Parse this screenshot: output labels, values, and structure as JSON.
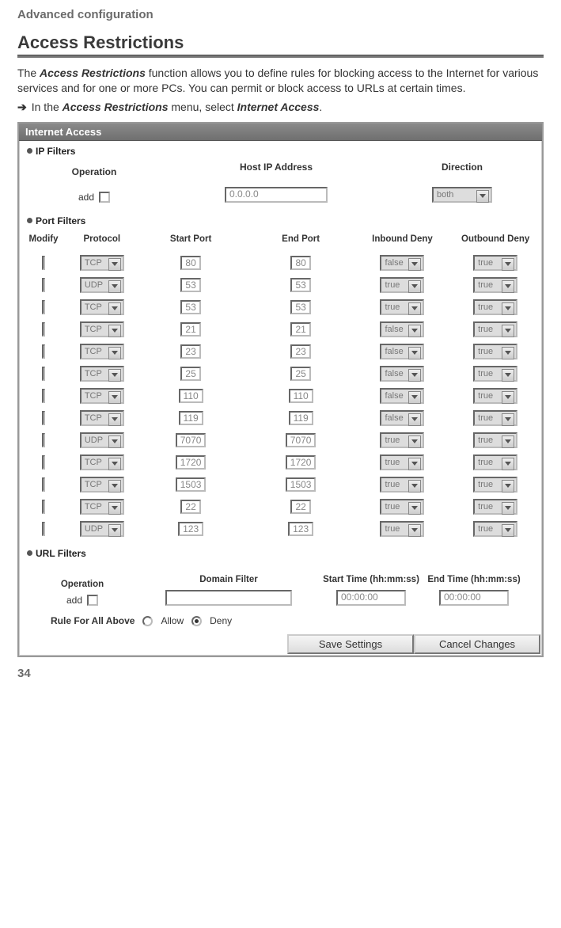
{
  "breadcrumb": "Advanced configuration",
  "section_title": "Access Restrictions",
  "intro_pre": "The ",
  "intro_bold1": "Access Restrictions",
  "intro_post1": " function allows you to define rules for blocking access to the Internet for various services and for one or more PCs. You can permit or block access to URLs at certain times.",
  "step_pre": "In the ",
  "step_bold1": "Access Restrictions",
  "step_mid": " menu, select ",
  "step_bold2": "Internet Access",
  "step_post": ".",
  "panel_title": "Internet Access",
  "ip_filters_label": "IP Filters",
  "ip_cols": {
    "c1": "Operation",
    "c2": "Host IP Address",
    "c3": "Direction"
  },
  "ip_add_label": "add",
  "ip_host_value": "0.0.0.0",
  "ip_direction": "both",
  "port_filters_label": "Port Filters",
  "port_cols": {
    "c1": "Modify",
    "c2": "Protocol",
    "c3": "Start Port",
    "c4": "End Port",
    "c5": "Inbound Deny",
    "c6": "Outbound Deny"
  },
  "port_rows": [
    {
      "protocol": "TCP",
      "start": "80",
      "end": "80",
      "inbound": "false",
      "outbound": "true"
    },
    {
      "protocol": "UDP",
      "start": "53",
      "end": "53",
      "inbound": "true",
      "outbound": "true"
    },
    {
      "protocol": "TCP",
      "start": "53",
      "end": "53",
      "inbound": "true",
      "outbound": "true"
    },
    {
      "protocol": "TCP",
      "start": "21",
      "end": "21",
      "inbound": "false",
      "outbound": "true"
    },
    {
      "protocol": "TCP",
      "start": "23",
      "end": "23",
      "inbound": "false",
      "outbound": "true"
    },
    {
      "protocol": "TCP",
      "start": "25",
      "end": "25",
      "inbound": "false",
      "outbound": "true"
    },
    {
      "protocol": "TCP",
      "start": "110",
      "end": "110",
      "inbound": "false",
      "outbound": "true"
    },
    {
      "protocol": "TCP",
      "start": "119",
      "end": "119",
      "inbound": "false",
      "outbound": "true"
    },
    {
      "protocol": "UDP",
      "start": "7070",
      "end": "7070",
      "inbound": "true",
      "outbound": "true"
    },
    {
      "protocol": "TCP",
      "start": "1720",
      "end": "1720",
      "inbound": "true",
      "outbound": "true"
    },
    {
      "protocol": "TCP",
      "start": "1503",
      "end": "1503",
      "inbound": "true",
      "outbound": "true"
    },
    {
      "protocol": "TCP",
      "start": "22",
      "end": "22",
      "inbound": "true",
      "outbound": "true"
    },
    {
      "protocol": "UDP",
      "start": "123",
      "end": "123",
      "inbound": "true",
      "outbound": "true"
    }
  ],
  "url_filters_label": "URL Filters",
  "url_cols": {
    "c1": "Operation",
    "c2": "Domain Filter",
    "c3": "Start Time (hh:mm:ss)",
    "c4": "End Time (hh:mm:ss)"
  },
  "url_add_label": "add",
  "url_start_time": "00:00:00",
  "url_end_time": "00:00:00",
  "rule_label": "Rule For All Above",
  "rule_allow": "Allow",
  "rule_deny": "Deny",
  "btn_save": "Save Settings",
  "btn_cancel": "Cancel Changes",
  "page_number": "34"
}
